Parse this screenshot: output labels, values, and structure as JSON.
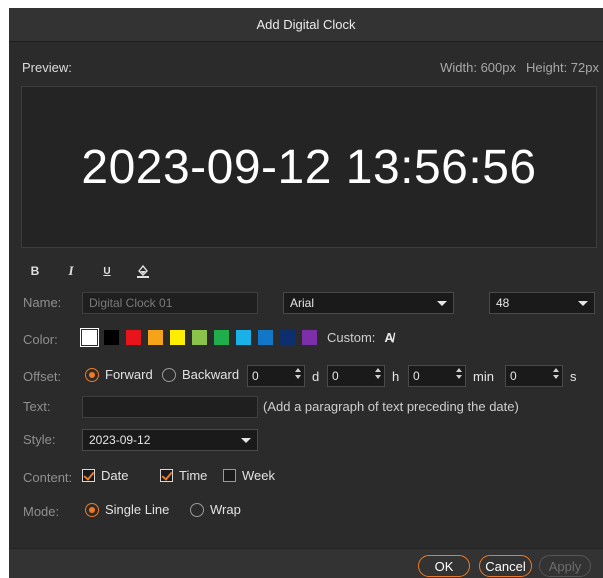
{
  "window": {
    "title": "Add Digital Clock"
  },
  "preview": {
    "label": "Preview:",
    "width_text": "Width: 600px",
    "height_text": "Height: 72px",
    "clock_text": "2023-09-12 13:56:56"
  },
  "format": {
    "bold": "B",
    "italic": "I",
    "underline": "U"
  },
  "name": {
    "label": "Name:",
    "value": "Digital Clock 01",
    "font": "Arial",
    "size": "48"
  },
  "color": {
    "label": "Color:",
    "swatches": [
      "#ffffff",
      "#000000",
      "#e8141b",
      "#f5a31a",
      "#ffee00",
      "#8bc34a",
      "#1fae4b",
      "#1ab0e8",
      "#1277c7",
      "#0d2f6e",
      "#7b2fa8"
    ],
    "selected": "#ffffff",
    "custom_label": "Custom:",
    "custom_icon": "text-color-picker-icon"
  },
  "offset": {
    "label": "Offset:",
    "forward": "Forward",
    "backward": "Backward",
    "selected": "Forward",
    "days": "0",
    "days_unit": "d",
    "hours": "0",
    "hours_unit": "h",
    "minutes": "0",
    "minutes_unit": "min",
    "seconds": "0",
    "seconds_unit": "s"
  },
  "text": {
    "label": "Text:",
    "value": "",
    "hint": "(Add a paragraph of text preceding the date)"
  },
  "style": {
    "label": "Style:",
    "value": "2023-09-12"
  },
  "content": {
    "label": "Content:",
    "date": "Date",
    "date_checked": true,
    "time": "Time",
    "time_checked": true,
    "week": "Week",
    "week_checked": false
  },
  "mode": {
    "label": "Mode:",
    "single_line": "Single Line",
    "wrap": "Wrap",
    "selected": "Single Line"
  },
  "buttons": {
    "ok": "OK",
    "cancel": "Cancel",
    "apply": "Apply"
  },
  "colors": {
    "accent": "#f07a22",
    "background": "#2b2b2b",
    "preview_bg": "#242424"
  }
}
